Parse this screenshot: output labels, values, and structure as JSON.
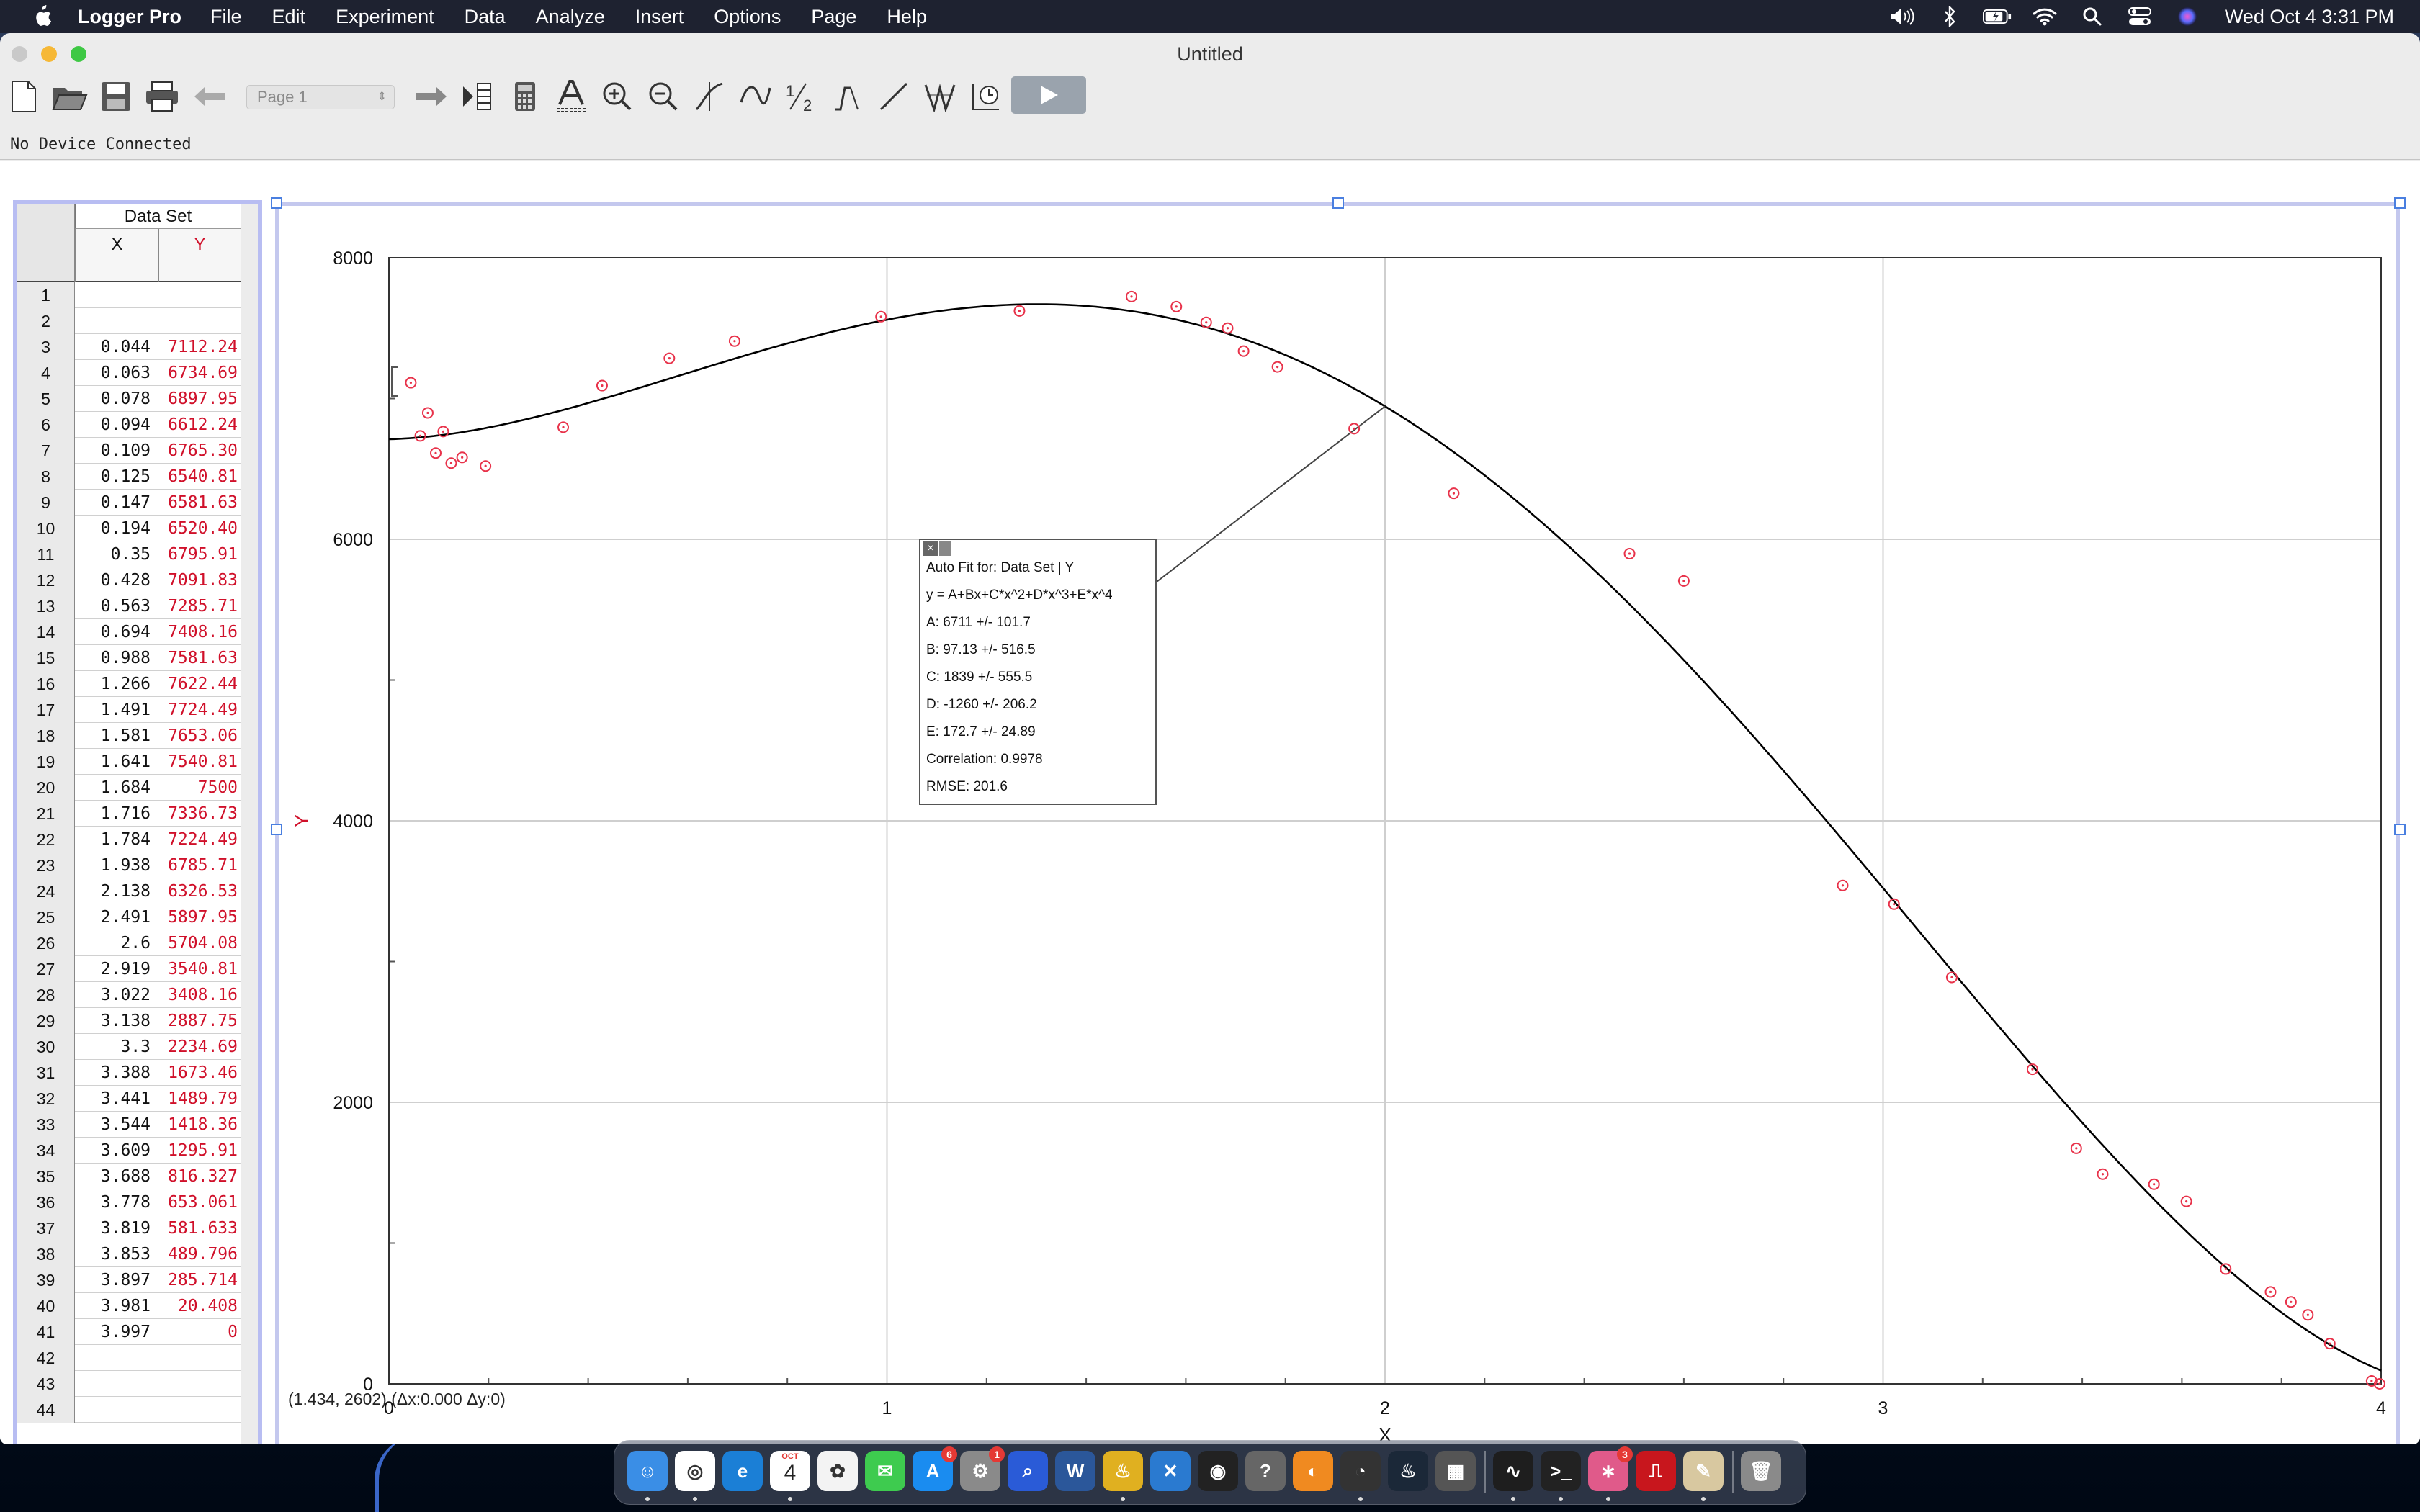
{
  "menubar": {
    "app_name": "Logger Pro",
    "items": [
      "File",
      "Edit",
      "Experiment",
      "Data",
      "Analyze",
      "Insert",
      "Options",
      "Page",
      "Help"
    ],
    "clock": "Wed Oct 4  3:31 PM"
  },
  "window": {
    "title": "Untitled",
    "page_select": "Page 1",
    "status": "No Device Connected"
  },
  "table": {
    "dataset_title": "Data Set",
    "x_header": "X",
    "y_header": "Y",
    "rows": [
      {
        "n": "1",
        "x": "",
        "y": ""
      },
      {
        "n": "2",
        "x": "",
        "y": ""
      },
      {
        "n": "3",
        "x": "0.044",
        "y": "7112.24"
      },
      {
        "n": "4",
        "x": "0.063",
        "y": "6734.69"
      },
      {
        "n": "5",
        "x": "0.078",
        "y": "6897.95"
      },
      {
        "n": "6",
        "x": "0.094",
        "y": "6612.24"
      },
      {
        "n": "7",
        "x": "0.109",
        "y": "6765.30"
      },
      {
        "n": "8",
        "x": "0.125",
        "y": "6540.81"
      },
      {
        "n": "9",
        "x": "0.147",
        "y": "6581.63"
      },
      {
        "n": "10",
        "x": "0.194",
        "y": "6520.40"
      },
      {
        "n": "11",
        "x": "0.35",
        "y": "6795.91"
      },
      {
        "n": "12",
        "x": "0.428",
        "y": "7091.83"
      },
      {
        "n": "13",
        "x": "0.563",
        "y": "7285.71"
      },
      {
        "n": "14",
        "x": "0.694",
        "y": "7408.16"
      },
      {
        "n": "15",
        "x": "0.988",
        "y": "7581.63"
      },
      {
        "n": "16",
        "x": "1.266",
        "y": "7622.44"
      },
      {
        "n": "17",
        "x": "1.491",
        "y": "7724.49"
      },
      {
        "n": "18",
        "x": "1.581",
        "y": "7653.06"
      },
      {
        "n": "19",
        "x": "1.641",
        "y": "7540.81"
      },
      {
        "n": "20",
        "x": "1.684",
        "y": "7500"
      },
      {
        "n": "21",
        "x": "1.716",
        "y": "7336.73"
      },
      {
        "n": "22",
        "x": "1.784",
        "y": "7224.49"
      },
      {
        "n": "23",
        "x": "1.938",
        "y": "6785.71"
      },
      {
        "n": "24",
        "x": "2.138",
        "y": "6326.53"
      },
      {
        "n": "25",
        "x": "2.491",
        "y": "5897.95"
      },
      {
        "n": "26",
        "x": "2.6",
        "y": "5704.08"
      },
      {
        "n": "27",
        "x": "2.919",
        "y": "3540.81"
      },
      {
        "n": "28",
        "x": "3.022",
        "y": "3408.16"
      },
      {
        "n": "29",
        "x": "3.138",
        "y": "2887.75"
      },
      {
        "n": "30",
        "x": "3.3",
        "y": "2234.69"
      },
      {
        "n": "31",
        "x": "3.388",
        "y": "1673.46"
      },
      {
        "n": "32",
        "x": "3.441",
        "y": "1489.79"
      },
      {
        "n": "33",
        "x": "3.544",
        "y": "1418.36"
      },
      {
        "n": "34",
        "x": "3.609",
        "y": "1295.91"
      },
      {
        "n": "35",
        "x": "3.688",
        "y": "816.327"
      },
      {
        "n": "36",
        "x": "3.778",
        "y": "653.061"
      },
      {
        "n": "37",
        "x": "3.819",
        "y": "581.633"
      },
      {
        "n": "38",
        "x": "3.853",
        "y": "489.796"
      },
      {
        "n": "39",
        "x": "3.897",
        "y": "285.714"
      },
      {
        "n": "40",
        "x": "3.981",
        "y": "20.408"
      },
      {
        "n": "41",
        "x": "3.997",
        "y": "0"
      },
      {
        "n": "42",
        "x": "",
        "y": ""
      },
      {
        "n": "43",
        "x": "",
        "y": ""
      },
      {
        "n": "44",
        "x": "",
        "y": ""
      }
    ]
  },
  "graph": {
    "coord_readout": "(1.434, 2602) (Δx:0.000 Δy:0)",
    "fit_box": {
      "lines": [
        "Auto Fit for: Data Set | Y",
        "y = A+Bx+C*x^2+D*x^3+E*x^4",
        "A: 6711 +/- 101.7",
        "B: 97.13 +/- 516.5",
        "C: 1839 +/- 555.5",
        "D: -1260 +/- 206.2",
        "E: 172.7 +/- 24.89",
        "Correlation: 0.9978",
        "RMSE: 201.6"
      ]
    }
  },
  "chart_data": {
    "type": "scatter",
    "title": "",
    "xlabel": "X",
    "ylabel": "Y",
    "xlim": [
      0,
      4
    ],
    "ylim": [
      0,
      8000
    ],
    "x_ticks": [
      "0",
      "1",
      "2",
      "3",
      "4"
    ],
    "y_ticks": [
      "0",
      "2000",
      "4000",
      "6000",
      "8000"
    ],
    "grid": true,
    "series": [
      {
        "x": [
          0.044,
          0.063,
          0.078,
          0.094,
          0.109,
          0.125,
          0.147,
          0.194,
          0.35,
          0.428,
          0.563,
          0.694,
          0.988,
          1.266,
          1.491,
          1.581,
          1.641,
          1.684,
          1.716,
          1.784,
          1.938,
          2.138,
          2.491,
          2.6,
          2.919,
          3.022,
          3.138,
          3.3,
          3.388,
          3.441,
          3.544,
          3.609,
          3.688,
          3.778,
          3.819,
          3.853,
          3.897,
          3.981,
          3.997
        ],
        "y": [
          7112.24,
          6734.69,
          6897.95,
          6612.24,
          6765.3,
          6540.81,
          6581.63,
          6520.4,
          6795.91,
          7091.83,
          7285.71,
          7408.16,
          7581.63,
          7622.44,
          7724.49,
          7653.06,
          7540.81,
          7500,
          7336.73,
          7224.49,
          6785.71,
          6326.53,
          5897.95,
          5704.08,
          3540.81,
          3408.16,
          2887.75,
          2234.69,
          1673.46,
          1489.79,
          1418.36,
          1295.91,
          816.327,
          653.061,
          581.633,
          489.796,
          285.714,
          20.408,
          0
        ],
        "color": "#e8324a"
      }
    ],
    "fit": {
      "model": "y = A+Bx+C*x^2+D*x^3+E*x^4",
      "A": 6711,
      "B": 97.13,
      "C": 1839,
      "D": -1260,
      "E": 172.7,
      "color": "#000000"
    }
  },
  "dock": {
    "apps": [
      "finder-icon",
      "chrome-icon",
      "edge-icon",
      "calendar-icon",
      "photos-icon",
      "messages-icon",
      "app-store-icon",
      "system-settings-icon",
      "quicktime-icon",
      "word-icon",
      "logger-pro-icon",
      "vscode-icon",
      "github-icon",
      "help-icon",
      "blender-icon",
      "davinci-icon",
      "steam-icon",
      "calculator-icon",
      "activity-monitor-icon",
      "terminal-icon",
      "grapher-icon",
      "acrobat-icon",
      "preview-icon",
      "trash-icon"
    ],
    "calendar_month": "OCT",
    "calendar_day": "4",
    "app_store_badge": "6",
    "settings_badge": "1",
    "grapher_badge": "3"
  }
}
